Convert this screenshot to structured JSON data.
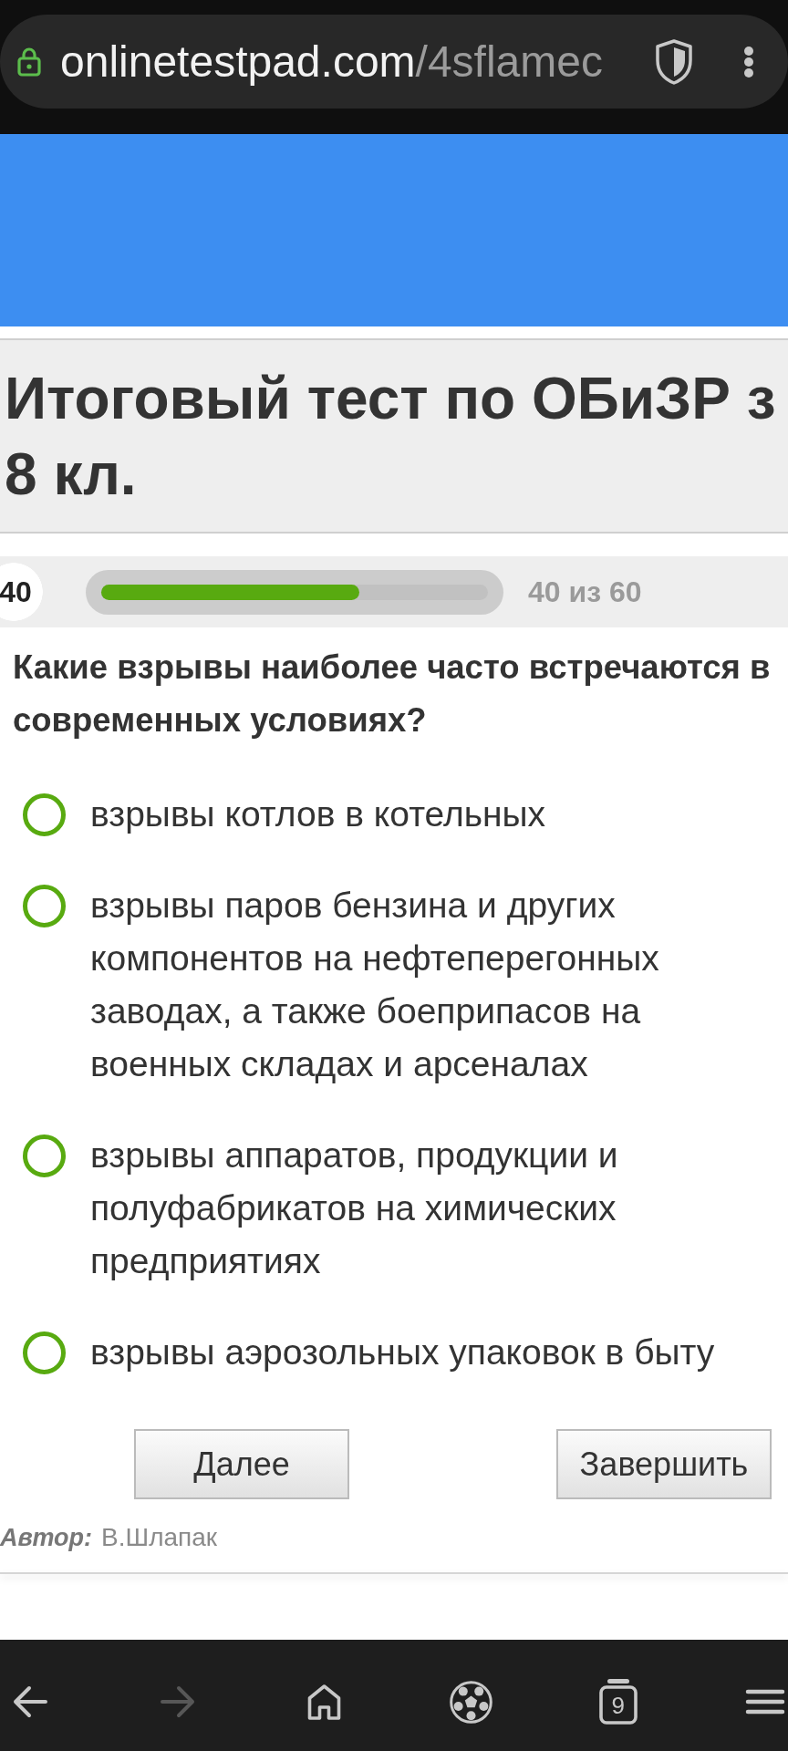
{
  "browser": {
    "secure": true,
    "url_host": "onlinetestpad.com",
    "url_path": "/4sflamec"
  },
  "test": {
    "title_lines": [
      "Итоговый тест по ОБиЗР з",
      "8 кл."
    ]
  },
  "progress": {
    "question_number": "40",
    "level": 0.667,
    "label": "40 из 60"
  },
  "question": {
    "text": "Какие взрывы наиболее часто встречаются в современных условиях?",
    "options": [
      {
        "label": "взрывы котлов в котельных",
        "selected": false
      },
      {
        "label": "взрывы паров бензина и других компонентов на нефтеперегонных заводах, а также боеприпасов на военных складах и арсеналах",
        "selected": false
      },
      {
        "label": "взрывы аппаратов, продукции и полуфабрикатов на химических предприятиях",
        "selected": false
      },
      {
        "label": "взрывы аэрозольных упаковок в быту",
        "selected": false
      }
    ]
  },
  "buttons": [
    {
      "label": "Далее"
    },
    {
      "label": "Завершить"
    }
  ],
  "author": {
    "label": "Автор:",
    "name": "В.Шлапак"
  },
  "nav_bar": {
    "items": [
      {
        "kind": "back",
        "disabled": false
      },
      {
        "kind": "forward",
        "disabled": true
      },
      {
        "kind": "home",
        "disabled": false
      },
      {
        "kind": "ball",
        "disabled": false
      },
      {
        "kind": "tabs",
        "disabled": false,
        "count": "9"
      },
      {
        "kind": "menu",
        "disabled": false
      }
    ]
  }
}
